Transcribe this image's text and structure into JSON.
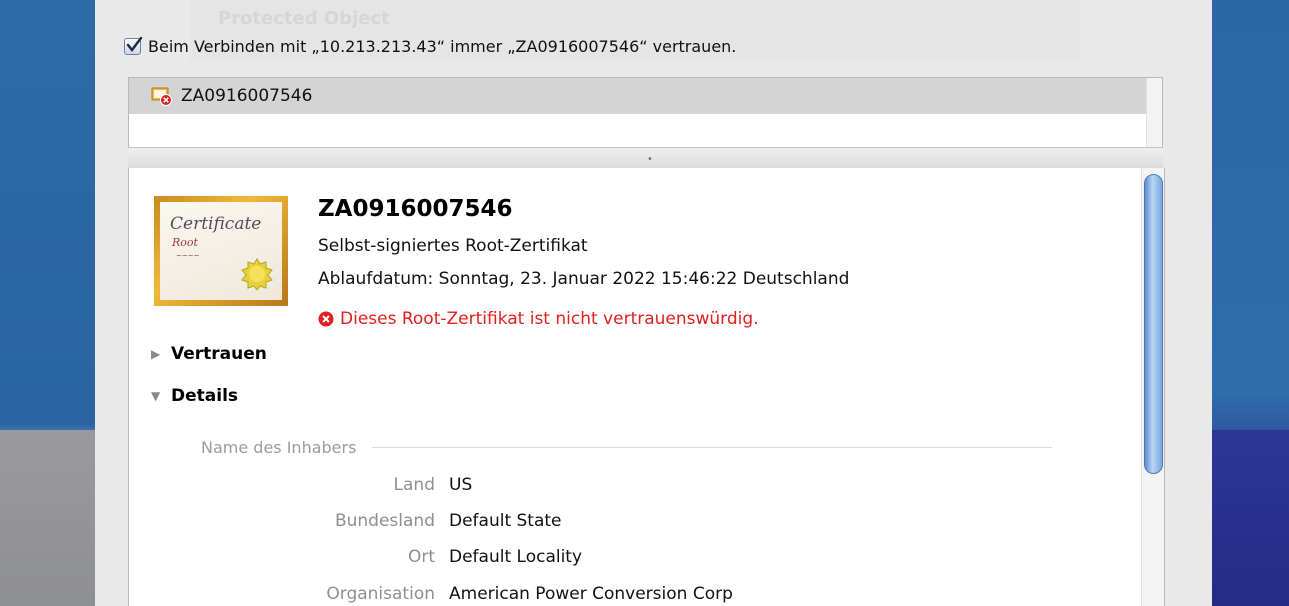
{
  "background_ghost_title": "Protected Object",
  "trust_checkbox": {
    "checked": true,
    "label": "Beim Verbinden mit „10.213.213.43“ immer „ZA0916007546“ vertrauen."
  },
  "certificate_list": {
    "items": [
      {
        "label": "ZA0916007546",
        "icon": "certificate-invalid-icon",
        "selected": true
      }
    ]
  },
  "details": {
    "title": "ZA0916007546",
    "subtitle": "Selbst-signiertes Root-Zertifikat",
    "expiry": "Ablaufdatum: Sonntag, 23. Januar 2022 15:46:22 Deutschland",
    "warning": "Dieses Root-Zertifikat ist nicht vertrauenswürdig.",
    "certificate_image_text": {
      "line1": "Certificate",
      "line2": "Root",
      "line3": "~~~~"
    },
    "sections": {
      "trust": "Vertrauen",
      "details": "Details"
    },
    "subject_heading": "Name des Inhabers",
    "fields": [
      {
        "key": "Land",
        "value": "US"
      },
      {
        "key": "Bundesland",
        "value": "Default State"
      },
      {
        "key": "Ort",
        "value": "Default Locality"
      },
      {
        "key": "Organisation",
        "value": "American Power Conversion Corp"
      }
    ]
  },
  "colors": {
    "warning": "#e0201e",
    "selection": "#d4d4d4",
    "scroll_thumb": "#7aa8e2"
  }
}
